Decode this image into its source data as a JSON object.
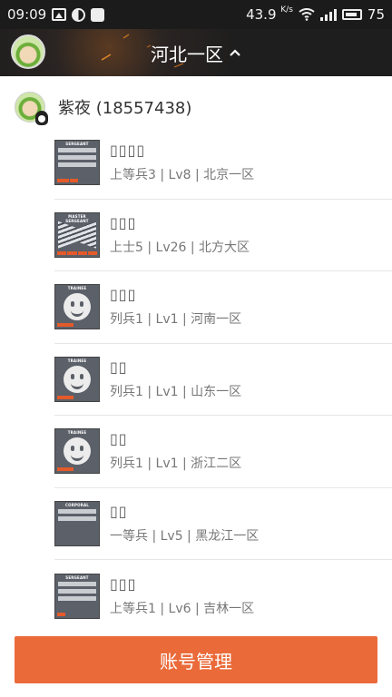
{
  "status_bar": {
    "time": "09:09",
    "net_speed": "43.9",
    "net_unit": "K/s",
    "battery": "75",
    "icons": [
      "image-icon",
      "half-circle-icon",
      "chat-icon",
      "wifi-icon",
      "signal-icon",
      "battery-icon"
    ]
  },
  "header": {
    "title": "河北一区",
    "avatar_icon": "user-avatar-icon",
    "toggle_icon": "chevron-up-icon",
    "accent_color": "#ea6a39"
  },
  "account": {
    "name": "紫夜 (18557438)"
  },
  "roles": [
    {
      "name": "▯▯▯▯",
      "desc": "上等兵3 | Lv8 | 北京一区",
      "badge": "SERGEANT",
      "rank_icon": "stripes",
      "bar_fill": 0.5
    },
    {
      "name": "▯▯▯",
      "desc": "上士5 | Lv26 | 北方大区",
      "badge": "MASTER SERGEANT",
      "rank_icon": "chevrons",
      "bar_fill": 1.0
    },
    {
      "name": "▯▯▯",
      "desc": "列兵1 | Lv1 | 河南一区",
      "badge": "TRAINEE",
      "rank_icon": "smile",
      "bar_fill": 0.4
    },
    {
      "name": "▯▯",
      "desc": "列兵1 | Lv1 | 山东一区",
      "badge": "TRAINEE",
      "rank_icon": "smile",
      "bar_fill": 0.4
    },
    {
      "name": "▯▯",
      "desc": "列兵1 | Lv1 | 浙江二区",
      "badge": "TRAINEE",
      "rank_icon": "smile",
      "bar_fill": 0.4
    },
    {
      "name": "▯▯",
      "desc": "一等兵 | Lv5 | 黑龙江一区",
      "badge": "CORPORAL",
      "rank_icon": "stripes",
      "bar_fill": 0.0
    },
    {
      "name": "▯▯▯",
      "desc": "上等兵1 | Lv6 | 吉林一区",
      "badge": "SERGEANT",
      "rank_icon": "stripes",
      "bar_fill": 0.2
    }
  ],
  "footer": {
    "manage_button": "账号管理"
  }
}
